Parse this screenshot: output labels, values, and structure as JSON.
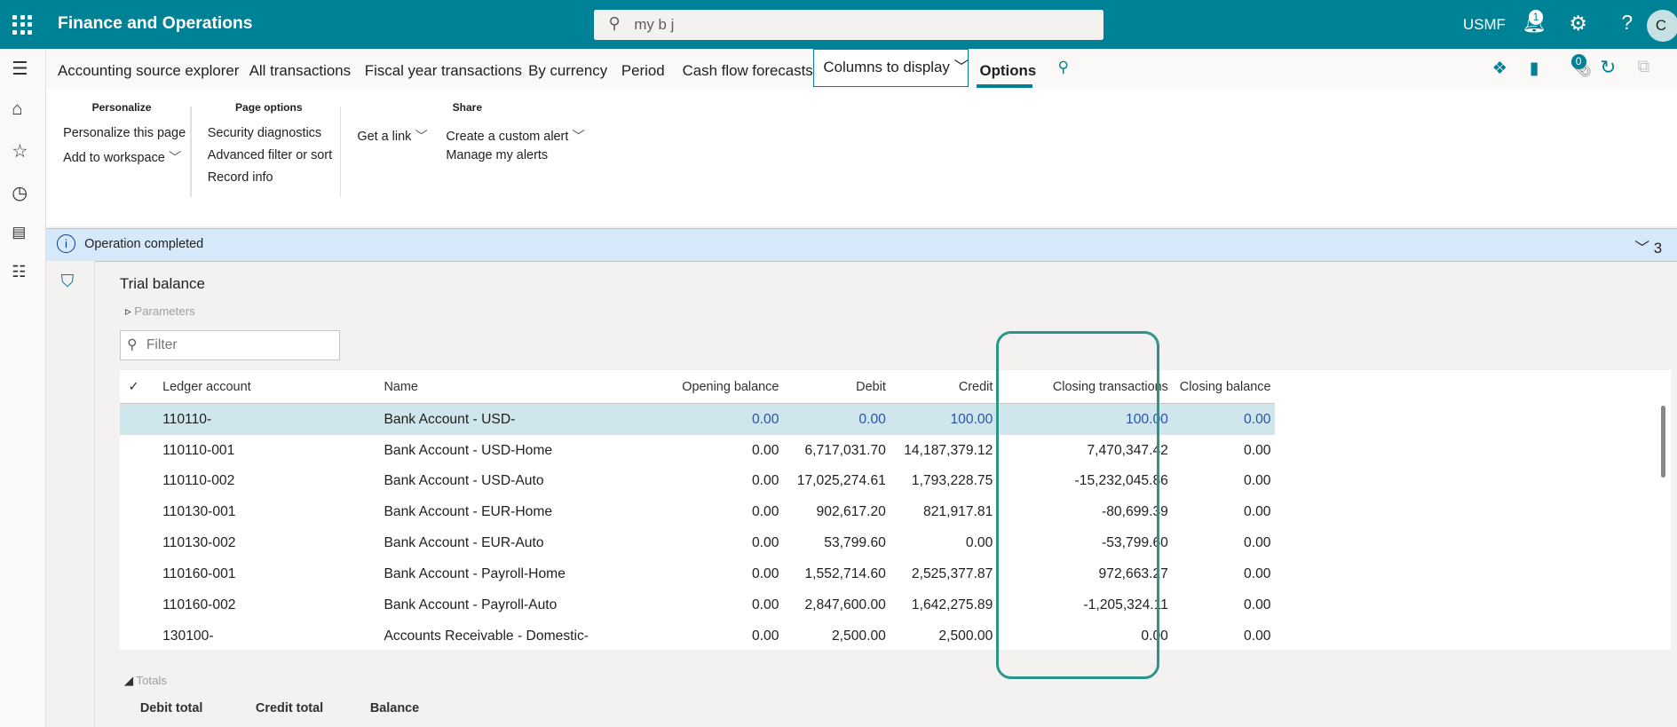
{
  "header": {
    "app_title": "Finance and Operations",
    "search_value": "my b j",
    "company": "USMF",
    "notification_count": "1",
    "avatar_initial": "C"
  },
  "action_tabs": [
    "Accounting source explorer",
    "All transactions",
    "Fiscal year transactions",
    "By currency",
    "Period",
    "Cash flow forecasts",
    "Columns to display",
    "Options"
  ],
  "active_tab": "Options",
  "attachment_count": "0",
  "ribbon": {
    "personalize": {
      "title": "Personalize",
      "items": [
        "Personalize this page",
        "Add to workspace"
      ]
    },
    "page_options": {
      "title": "Page options",
      "items": [
        "Security diagnostics",
        "Advanced filter or sort",
        "Record info"
      ]
    },
    "share": {
      "title": "Share",
      "items": [
        "Get a link",
        "Create a custom alert",
        "Manage my alerts"
      ]
    }
  },
  "message": {
    "text": "Operation completed",
    "count": "3"
  },
  "form": {
    "title": "Trial balance",
    "parameters": "Parameters",
    "filter_placeholder": "Filter"
  },
  "grid": {
    "columns": [
      "Ledger account",
      "Name",
      "Opening balance",
      "Debit",
      "Credit",
      "Closing transactions",
      "Closing balance"
    ],
    "rows": [
      [
        "110110-",
        "Bank Account - USD-",
        "0.00",
        "0.00",
        "100.00",
        "100.00",
        "0.00"
      ],
      [
        "110110-001",
        "Bank Account - USD-Home",
        "0.00",
        "6,717,031.70",
        "14,187,379.12",
        "7,470,347.42",
        "0.00"
      ],
      [
        "110110-002",
        "Bank Account - USD-Auto",
        "0.00",
        "17,025,274.61",
        "1,793,228.75",
        "-15,232,045.86",
        "0.00"
      ],
      [
        "110130-001",
        "Bank Account - EUR-Home",
        "0.00",
        "902,617.20",
        "821,917.81",
        "-80,699.39",
        "0.00"
      ],
      [
        "110130-002",
        "Bank Account - EUR-Auto",
        "0.00",
        "53,799.60",
        "0.00",
        "-53,799.60",
        "0.00"
      ],
      [
        "110160-001",
        "Bank Account - Payroll-Home",
        "0.00",
        "1,552,714.60",
        "2,525,377.87",
        "972,663.27",
        "0.00"
      ],
      [
        "110160-002",
        "Bank Account - Payroll-Auto",
        "0.00",
        "2,847,600.00",
        "1,642,275.89",
        "-1,205,324.11",
        "0.00"
      ],
      [
        "130100-",
        "Accounts Receivable - Domestic-",
        "0.00",
        "2,500.00",
        "2,500.00",
        "0.00",
        "0.00"
      ]
    ]
  },
  "totals": {
    "title": "Totals",
    "labels": [
      "Debit total",
      "Credit total",
      "Balance"
    ]
  },
  "colors": {
    "brand": "#008296",
    "highlight": "#2d9488",
    "selected_row": "#cfe6ec",
    "message_bar": "#d6e9fb"
  }
}
